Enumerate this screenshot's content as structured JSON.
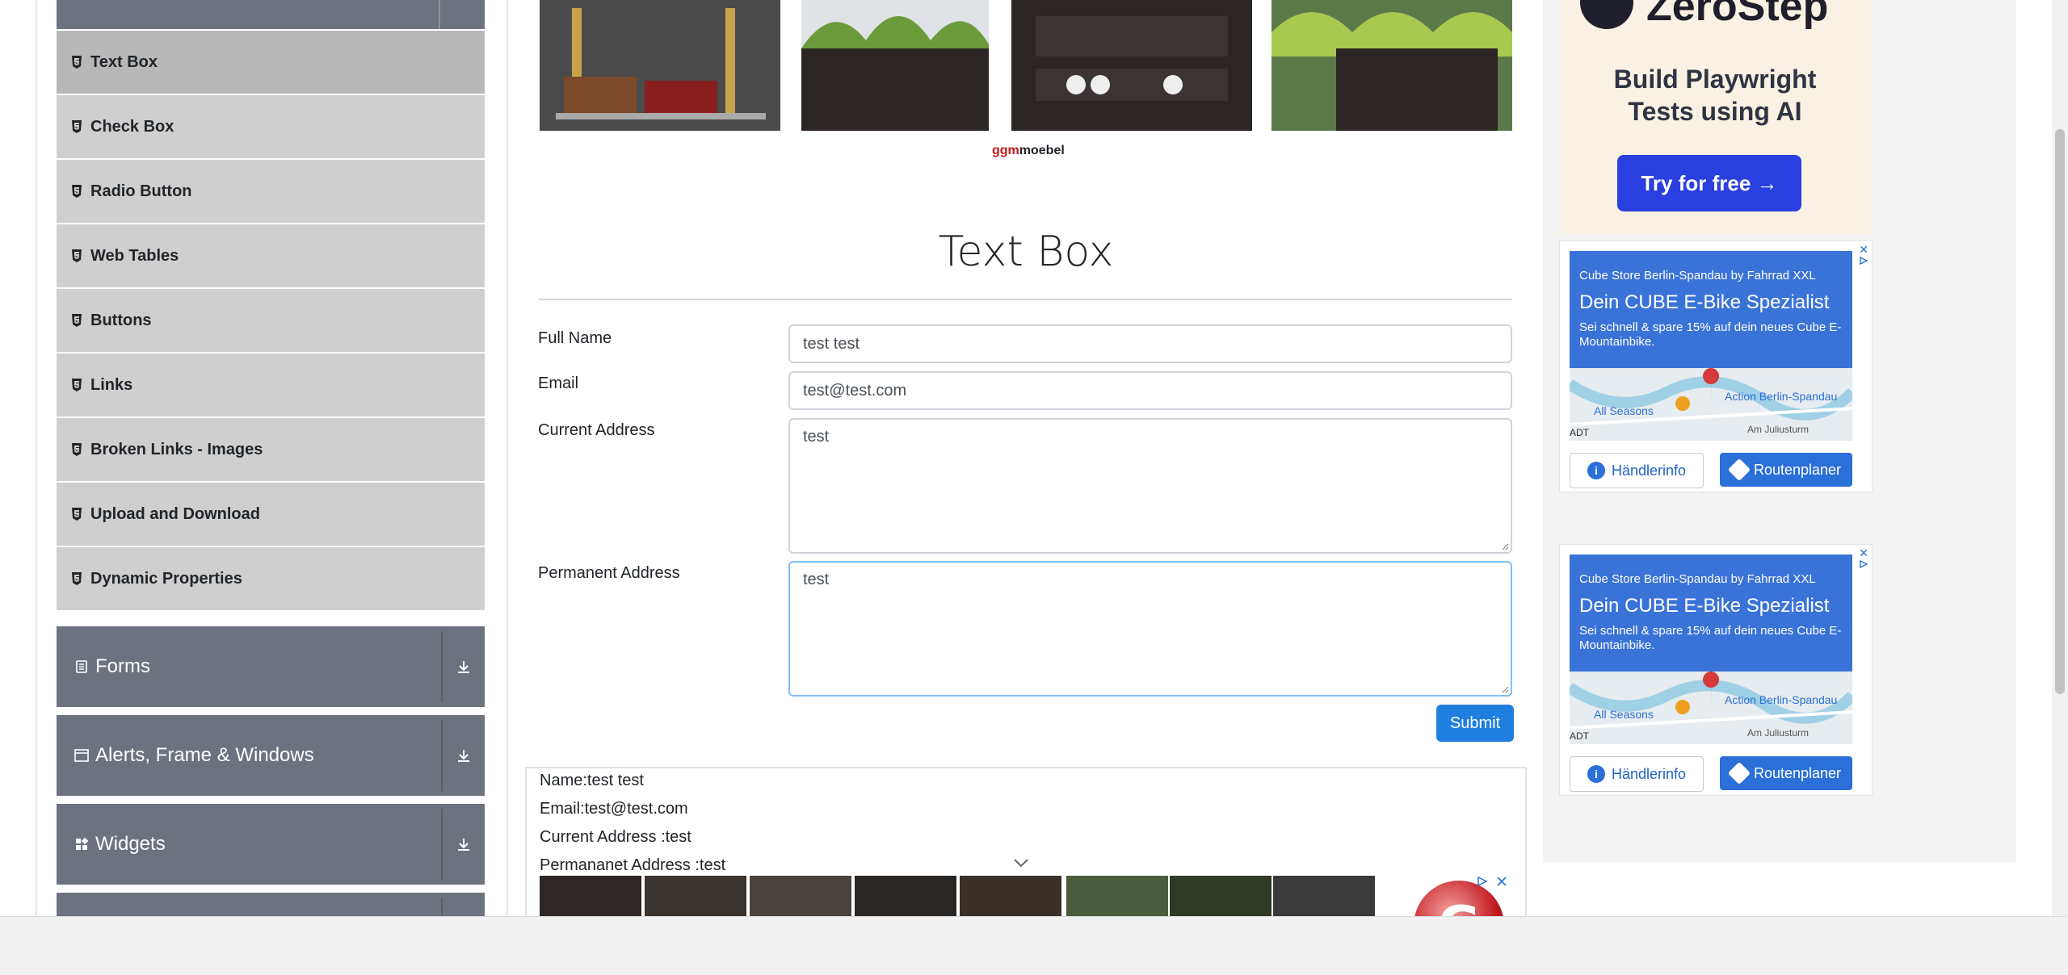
{
  "sidebar": {
    "items": [
      {
        "label": "Text Box",
        "icon": "html5-icon",
        "active": true
      },
      {
        "label": "Check Box",
        "icon": "html5-icon"
      },
      {
        "label": "Radio Button",
        "icon": "html5-icon"
      },
      {
        "label": "Web Tables",
        "icon": "html5-icon"
      },
      {
        "label": "Buttons",
        "icon": "html5-icon"
      },
      {
        "label": "Links",
        "icon": "html5-icon"
      },
      {
        "label": "Broken Links - Images",
        "icon": "html5-icon"
      },
      {
        "label": "Upload and Download",
        "icon": "html5-icon"
      },
      {
        "label": "Dynamic Properties",
        "icon": "html5-icon"
      }
    ],
    "groups": [
      {
        "label": "Forms",
        "icon": "form-icon"
      },
      {
        "label": "Alerts, Frame & Windows",
        "icon": "window-icon"
      },
      {
        "label": "Widgets",
        "icon": "widgets-icon"
      }
    ]
  },
  "ad_top": {
    "brand_prefix": "ggm",
    "brand_suffix": "moebel"
  },
  "main": {
    "title": "Text Box",
    "form": {
      "full_name_label": "Full Name",
      "full_name_value": "test test",
      "email_label": "Email",
      "email_value": "test@test.com",
      "current_address_label": "Current Address",
      "current_address_value": "test",
      "permanent_address_label": "Permanent Address",
      "permanent_address_value": "test",
      "submit_label": "Submit"
    },
    "output": {
      "name": "Name:test test",
      "email": "Email:test@test.com",
      "current_address": "Current Address :test",
      "permanent_address": "Permananet Address :test"
    }
  },
  "right_ads": {
    "zerostep": {
      "name": "ZeroStep",
      "headline_line1": "Build Playwright",
      "headline_line2": "Tests using AI",
      "button": "Try for free →"
    },
    "cube": {
      "store": "Cube Store Berlin-Spandau by Fahrrad XXL",
      "title": "Dein CUBE E-Bike Spezialist",
      "desc": "Sei schnell & spare 15% auf dein neues Cube E-Mountainbike.",
      "map_label1": "All Seasons",
      "map_label2": "Action Berlin-Spandau",
      "map_label3": "Am Juliusturm",
      "map_label4": "ADT",
      "btn_info": "Händlerinfo",
      "btn_route": "Routenplaner"
    }
  },
  "colors": {
    "accent": "#1f7fe0",
    "sidebar_group": "#6c737f",
    "sidebar_item": "#cfcfcf"
  }
}
